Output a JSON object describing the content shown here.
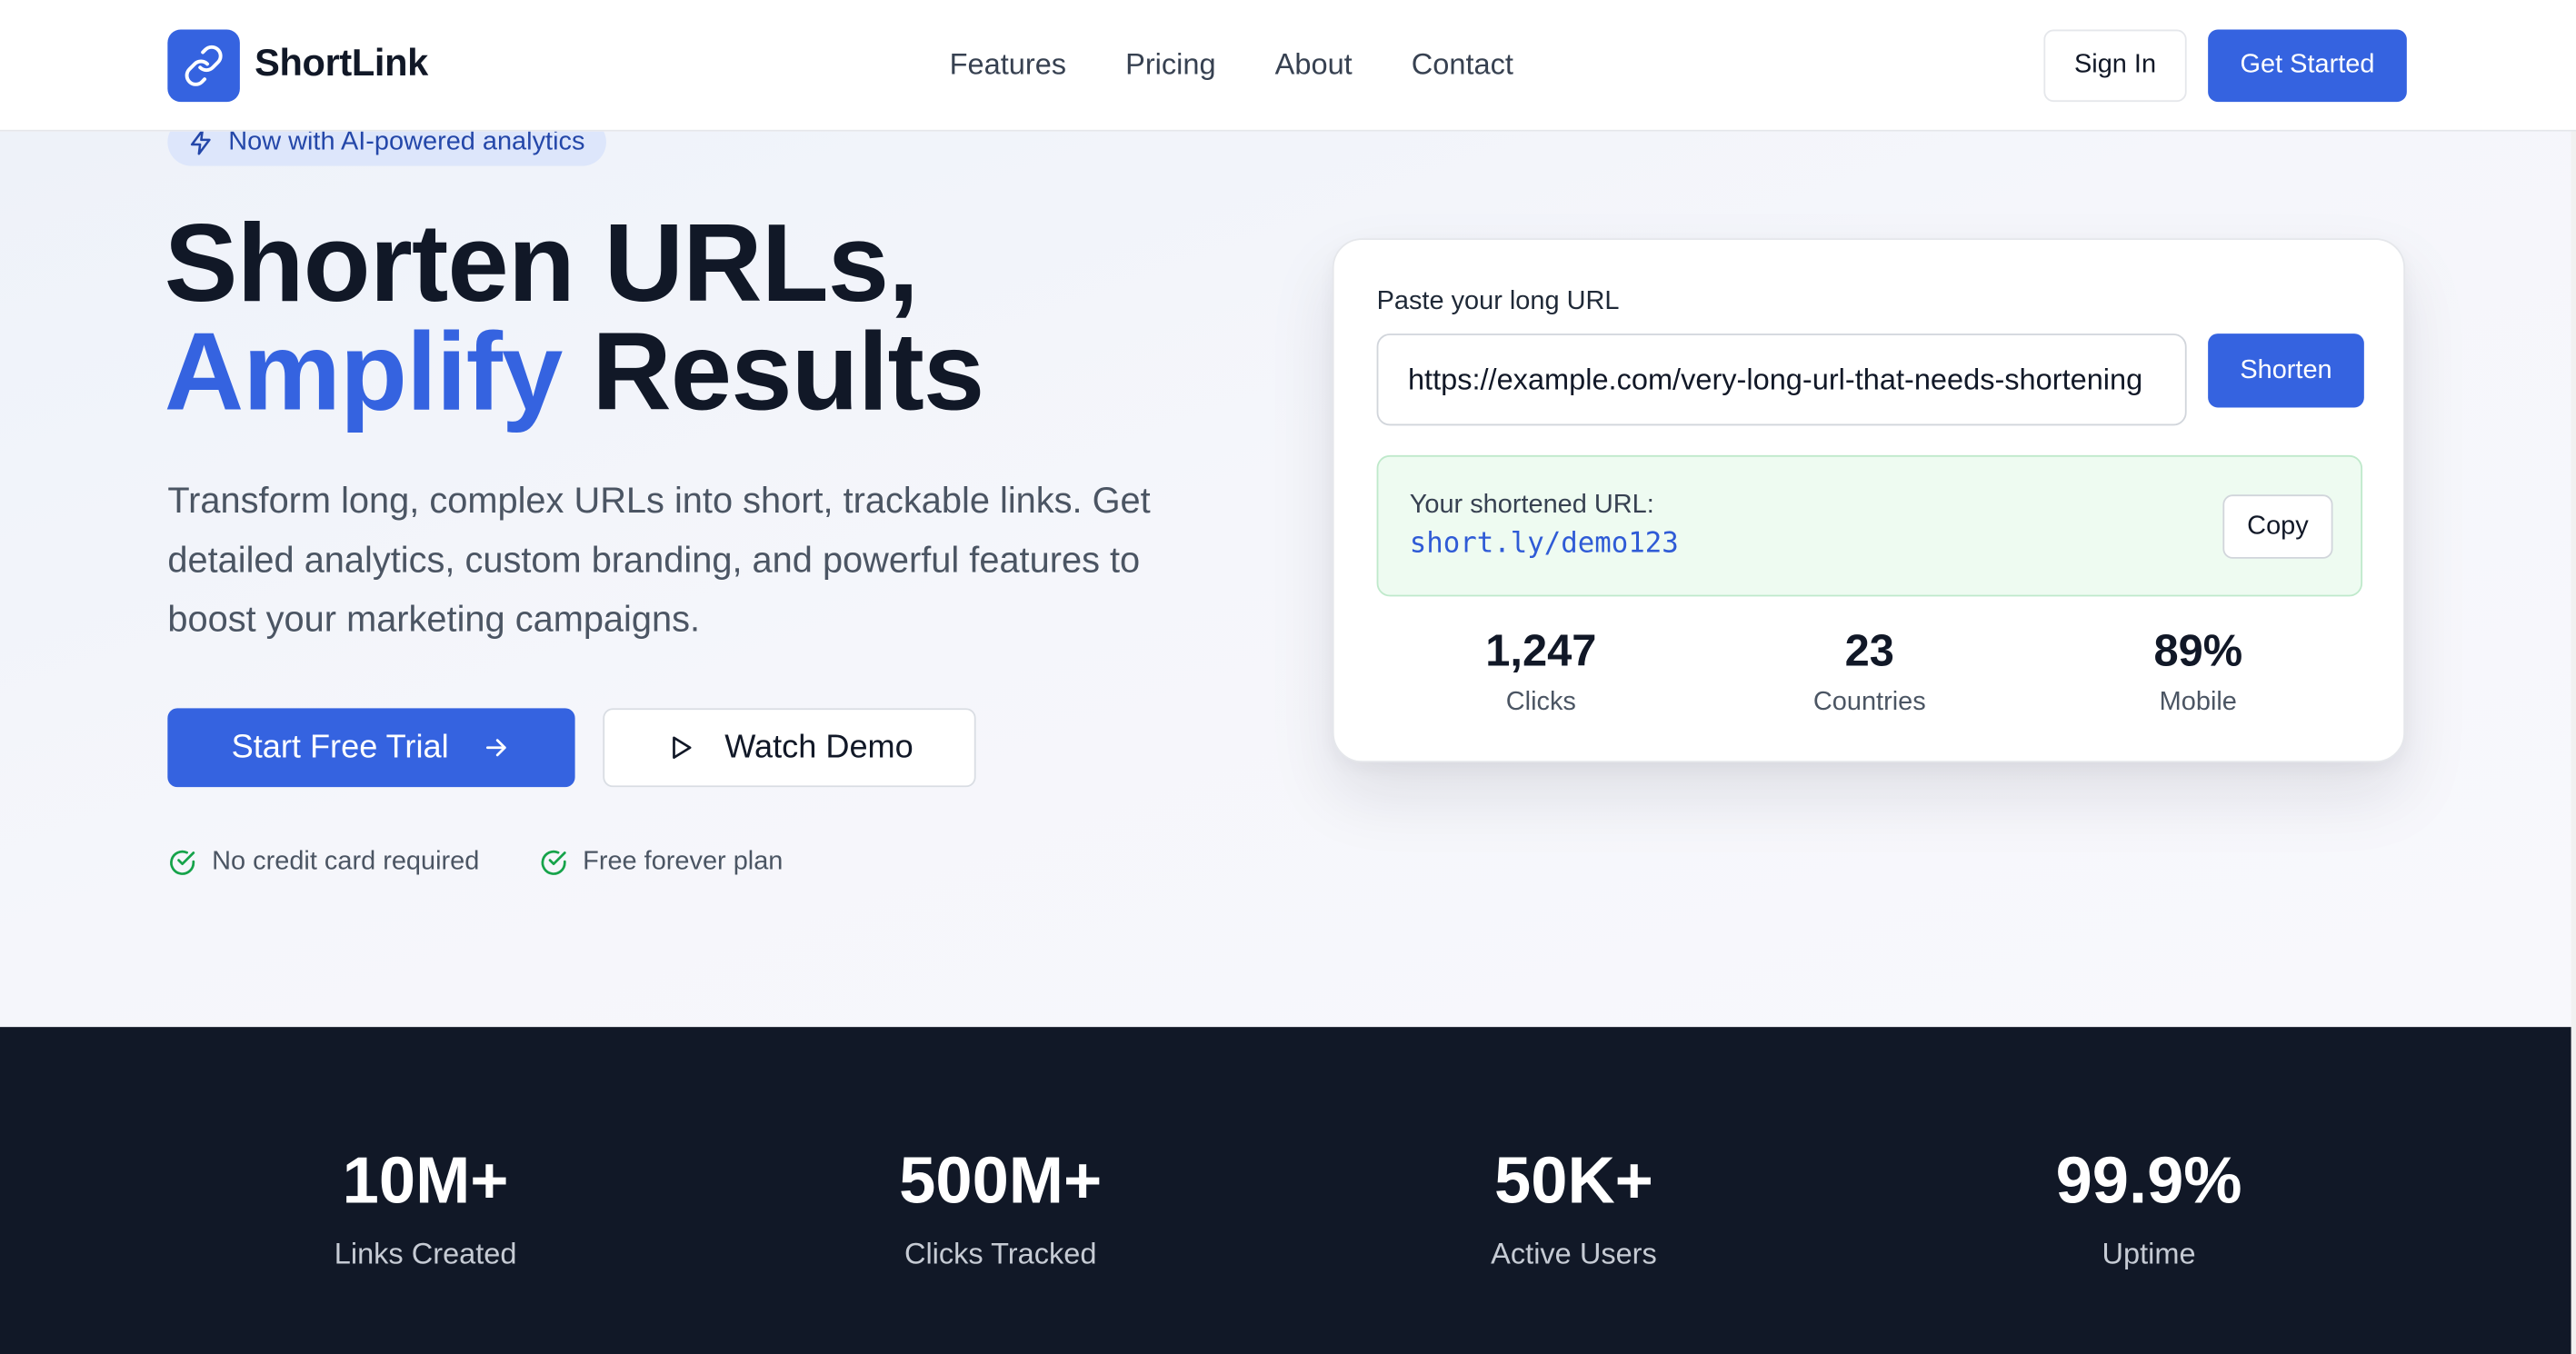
{
  "header": {
    "brand": "ShortLink",
    "nav": [
      "Features",
      "Pricing",
      "About",
      "Contact"
    ],
    "sign_in": "Sign In",
    "get_started": "Get Started"
  },
  "hero": {
    "badge": "Now with AI-powered analytics",
    "title_line1": "Shorten URLs,",
    "title_accent": "Amplify",
    "title_rest": " Results",
    "lead": "Transform long, complex URLs into short, trackable links. Get detailed analytics, custom branding, and powerful features to boost your marketing campaigns.",
    "cta_primary": "Start Free Trial",
    "cta_secondary": "Watch Demo",
    "checks": [
      "No credit card required",
      "Free forever plan"
    ]
  },
  "card": {
    "label": "Paste your long URL",
    "url_value": "https://example.com/very-long-url-that-needs-shortening",
    "shorten": "Shorten",
    "result_label": "Your shortened URL:",
    "result_url": "short.ly/demo123",
    "copy": "Copy",
    "stats": [
      {
        "value": "1,247",
        "label": "Clicks"
      },
      {
        "value": "23",
        "label": "Countries"
      },
      {
        "value": "89%",
        "label": "Mobile"
      }
    ]
  },
  "band": {
    "stats": [
      {
        "value": "10M+",
        "label": "Links Created"
      },
      {
        "value": "500M+",
        "label": "Clicks Tracked"
      },
      {
        "value": "50K+",
        "label": "Active Users"
      },
      {
        "value": "99.9%",
        "label": "Uptime"
      }
    ]
  },
  "colors": {
    "accent": "#3563e0",
    "dark_band": "#111827",
    "success_bg": "#eefbf1"
  }
}
